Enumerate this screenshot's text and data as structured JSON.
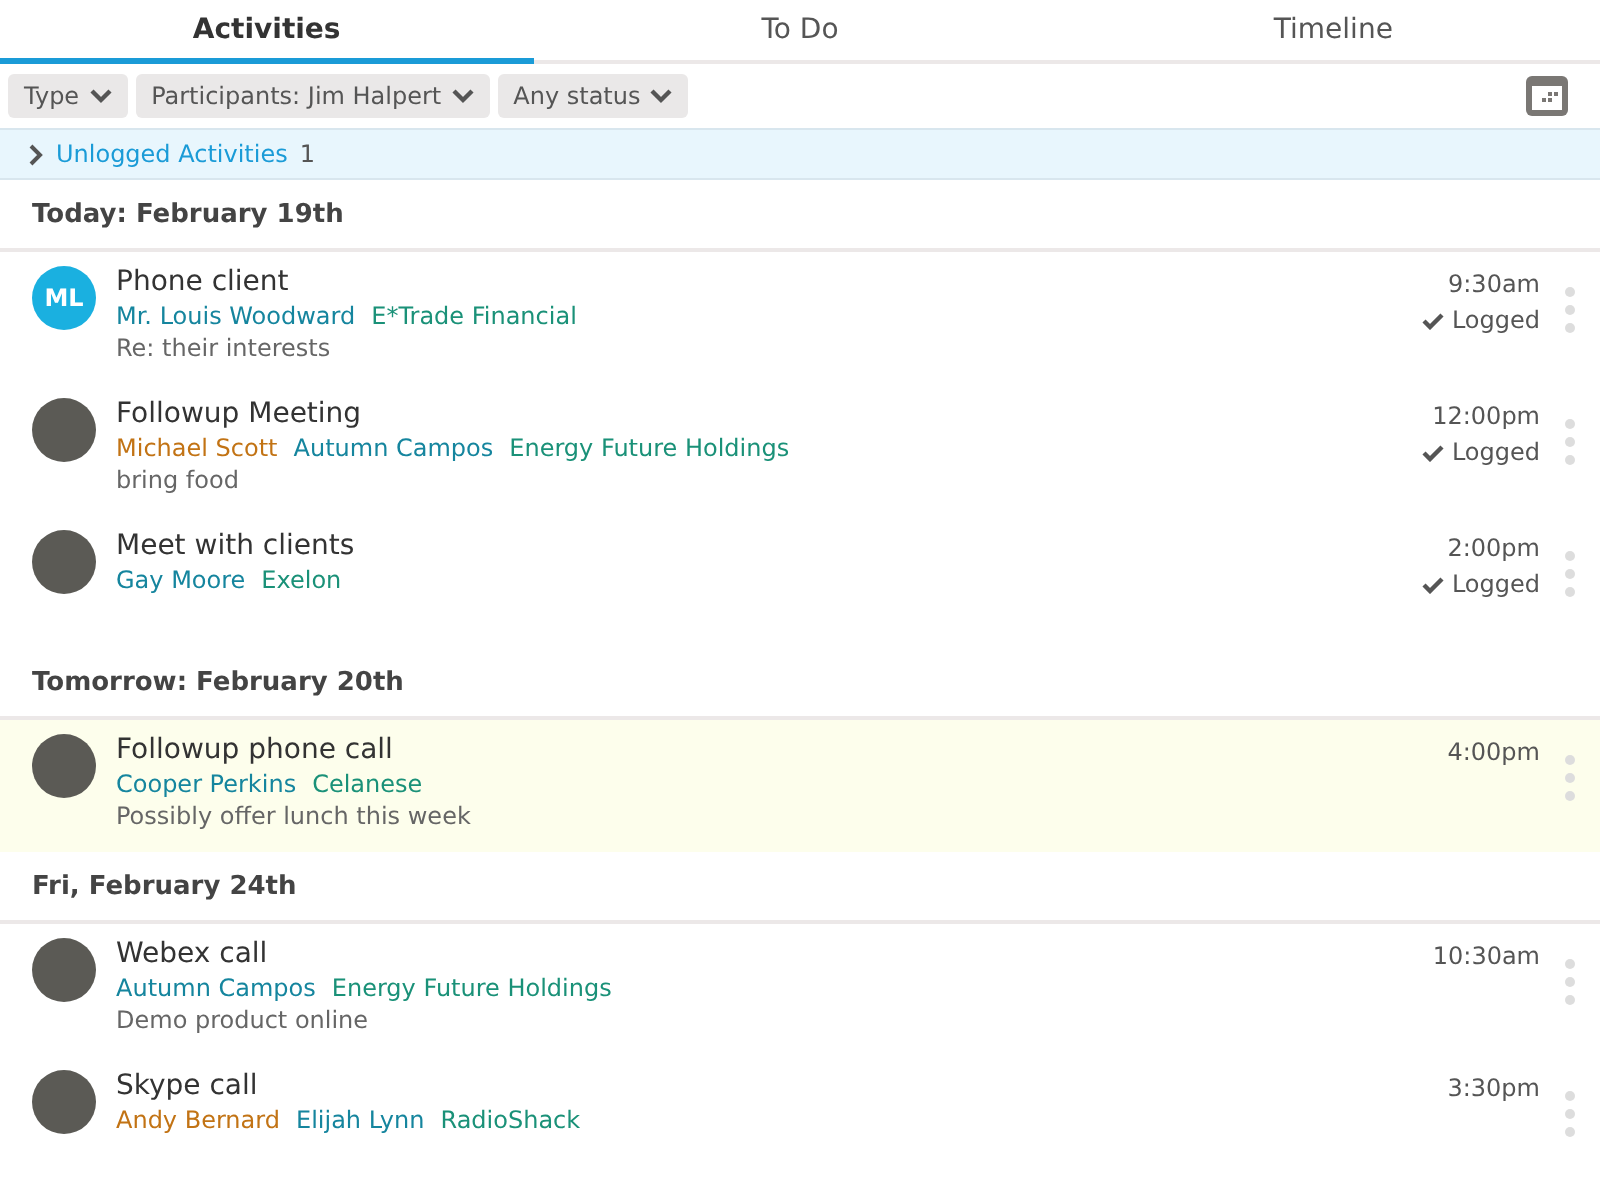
{
  "tabs": [
    {
      "label": "Activities",
      "selected": true
    },
    {
      "label": "To Do",
      "selected": false
    },
    {
      "label": "Timeline",
      "selected": false
    }
  ],
  "filters": [
    "Type",
    "Participants: Jim Halpert",
    "Any status"
  ],
  "unlogged": {
    "label": "Unlogged Activities",
    "count": "1",
    "expanded": false
  },
  "groups": [
    {
      "title": "Today: February 19th",
      "activities": [
        {
          "title": "Phone client",
          "avatar": {
            "kind": "initials",
            "initials": "ML"
          },
          "links": [
            {
              "text": "Mr. Louis Woodward",
              "kind": "person"
            },
            {
              "text": "E*Trade Financial",
              "kind": "company"
            }
          ],
          "note": "Re: their interests",
          "time": "9:30am",
          "logged": true,
          "status": "Logged",
          "highlighted": false
        },
        {
          "title": "Followup Meeting",
          "avatar": {
            "kind": "photo"
          },
          "links": [
            {
              "text": "Michael Scott",
              "kind": "user"
            },
            {
              "text": "Autumn Campos",
              "kind": "person"
            },
            {
              "text": "Energy Future Holdings",
              "kind": "company"
            }
          ],
          "note": "bring food",
          "time": "12:00pm",
          "logged": true,
          "status": "Logged",
          "highlighted": false
        },
        {
          "title": "Meet with clients",
          "avatar": {
            "kind": "photo"
          },
          "links": [
            {
              "text": "Gay Moore",
              "kind": "person"
            },
            {
              "text": "Exelon",
              "kind": "company"
            }
          ],
          "time": "2:00pm",
          "logged": true,
          "status": "Logged",
          "highlighted": false
        }
      ]
    },
    {
      "title": "Tomorrow: February 20th",
      "activities": [
        {
          "title": "Followup phone call",
          "avatar": {
            "kind": "photo"
          },
          "links": [
            {
              "text": "Cooper Perkins",
              "kind": "person"
            },
            {
              "text": "Celanese",
              "kind": "company"
            }
          ],
          "note": "Possibly offer lunch this week",
          "time": "4:00pm",
          "logged": false,
          "highlighted": true
        }
      ]
    },
    {
      "title": "Fri, February 24th",
      "activities": [
        {
          "title": "Webex call",
          "avatar": {
            "kind": "photo"
          },
          "links": [
            {
              "text": "Autumn Campos",
              "kind": "person"
            },
            {
              "text": "Energy Future Holdings",
              "kind": "company"
            }
          ],
          "note": "Demo product online",
          "time": "10:30am",
          "logged": false,
          "highlighted": false
        },
        {
          "title": "Skype call",
          "avatar": {
            "kind": "photo"
          },
          "links": [
            {
              "text": "Andy Bernard",
              "kind": "user"
            },
            {
              "text": "Elijah Lynn",
              "kind": "person"
            },
            {
              "text": "RadioShack",
              "kind": "company"
            }
          ],
          "time": "3:30pm",
          "logged": false,
          "highlighted": false
        }
      ]
    }
  ]
}
